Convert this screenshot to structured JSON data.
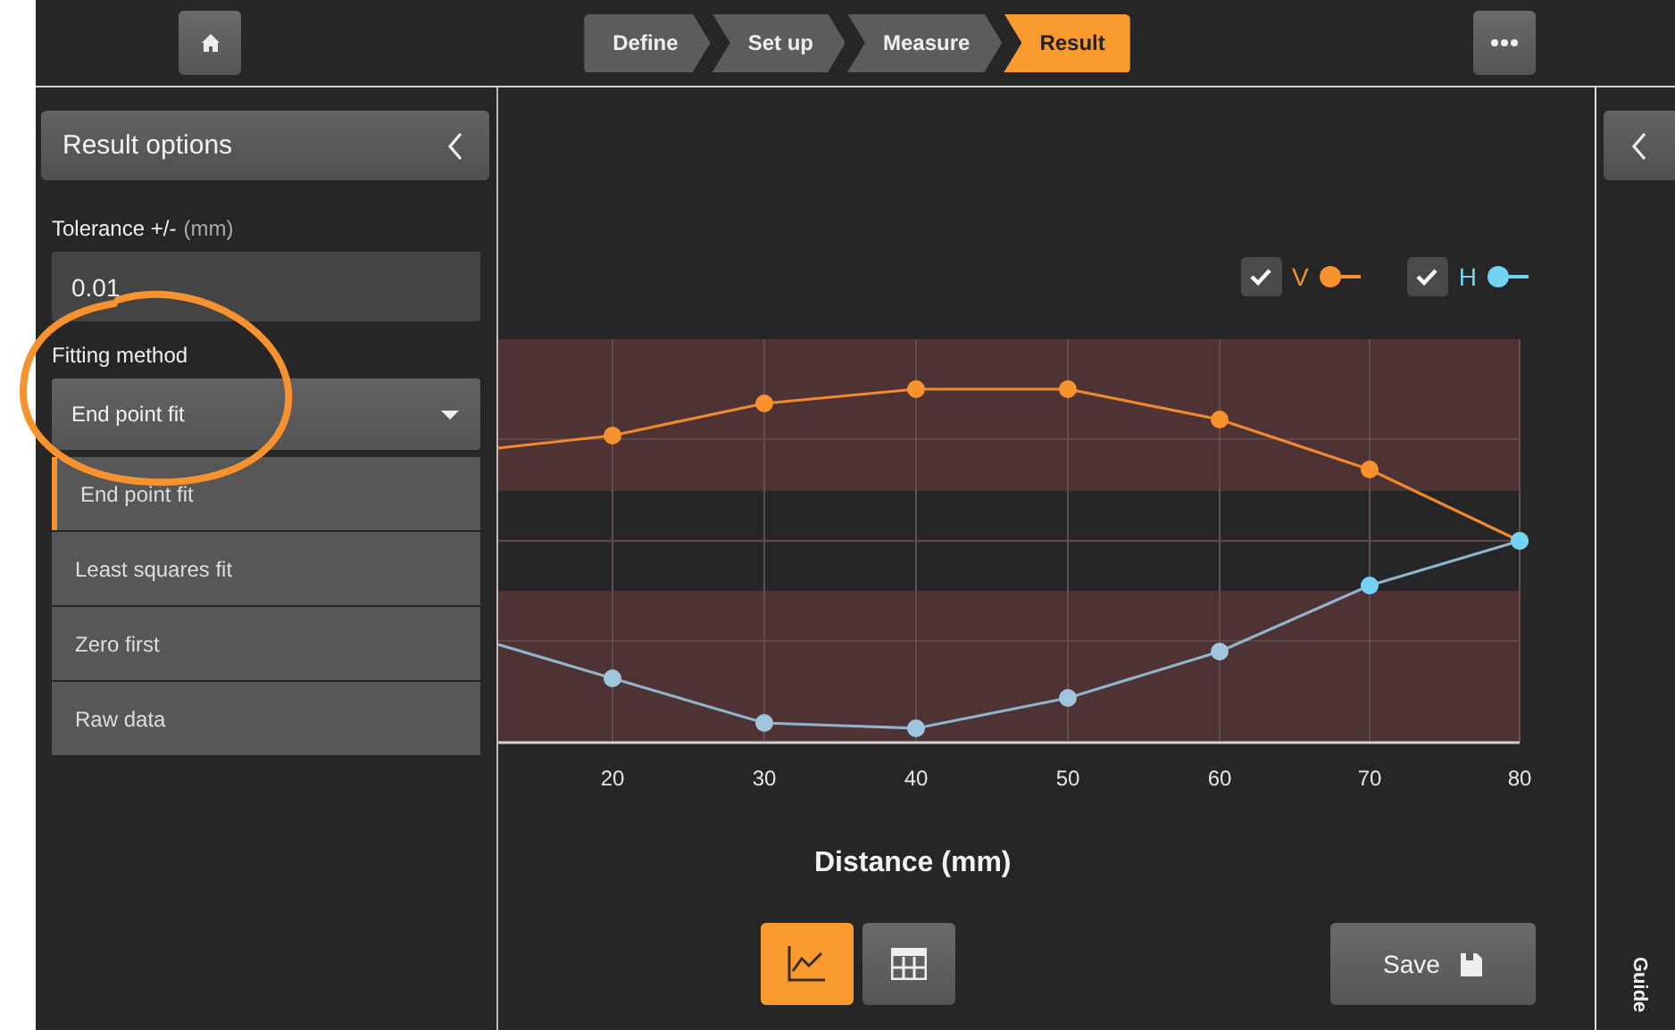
{
  "header": {
    "steps": [
      {
        "label": "Define",
        "selected": false
      },
      {
        "label": "Set up",
        "selected": false
      },
      {
        "label": "Measure",
        "selected": false
      },
      {
        "label": "Result",
        "selected": true
      }
    ]
  },
  "result_options": {
    "title": "Result options",
    "tolerance": {
      "label": "Tolerance +/-",
      "unit": "(mm)",
      "value": "0.01"
    },
    "fitting_method": {
      "label": "Fitting method",
      "value": "End point fit",
      "options": [
        {
          "label": "End point fit",
          "selected": true
        },
        {
          "label": "Least squares fit",
          "selected": false
        },
        {
          "label": "Zero first",
          "selected": false
        },
        {
          "label": "Raw data",
          "selected": false
        }
      ]
    }
  },
  "chart": {
    "legend": [
      {
        "label": "V",
        "checked": true,
        "color": "#f7922f"
      },
      {
        "label": "H",
        "checked": true,
        "color": "#72d3f2"
      }
    ],
    "x_tick_labels": [
      "20",
      "30",
      "40",
      "50",
      "60",
      "70",
      "80"
    ],
    "xlabel": "Distance (mm)"
  },
  "view_toggle": [
    {
      "kind": "chart",
      "selected": true
    },
    {
      "kind": "table",
      "selected": false
    }
  ],
  "save_button": "Save",
  "guide": "Guide"
}
